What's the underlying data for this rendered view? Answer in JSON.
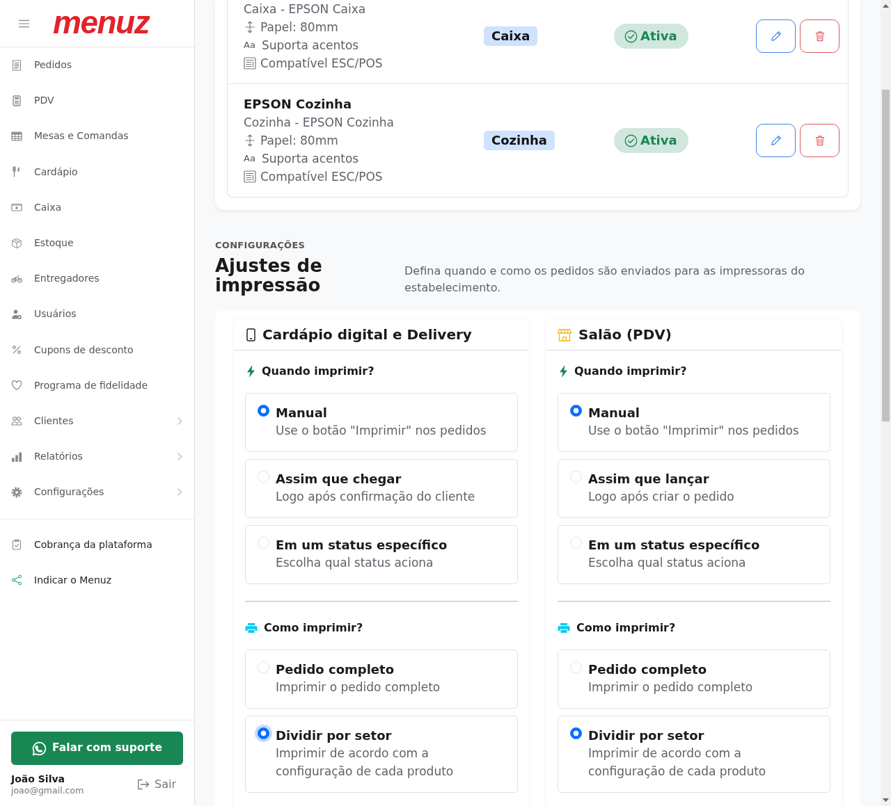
{
  "sidebar": {
    "logo": "menuz",
    "items": [
      {
        "label": "Pedidos",
        "has_submenu": false
      },
      {
        "label": "PDV",
        "has_submenu": false
      },
      {
        "label": "Mesas e Comandas",
        "has_submenu": false
      },
      {
        "label": "Cardápio",
        "has_submenu": false
      },
      {
        "label": "Caixa",
        "has_submenu": false
      },
      {
        "label": "Estoque",
        "has_submenu": false
      },
      {
        "label": "Entregadores",
        "has_submenu": false
      },
      {
        "label": "Usuários",
        "has_submenu": false
      },
      {
        "label": "Cupons de desconto",
        "has_submenu": false
      },
      {
        "label": "Programa de fidelidade",
        "has_submenu": false
      },
      {
        "label": "Clientes",
        "has_submenu": true
      },
      {
        "label": "Relatórios",
        "has_submenu": true
      },
      {
        "label": "Configurações",
        "has_submenu": true
      }
    ],
    "secondary_items": [
      {
        "label": "Cobrança da plataforma"
      },
      {
        "label": "Indicar o Menuz"
      }
    ],
    "support_button": "Falar com suporte",
    "user": {
      "name": "João Silva",
      "email": "joao@gmail.com"
    },
    "logout": "Sair"
  },
  "printers": [
    {
      "subtitle": "Caixa - EPSON Caixa",
      "details": [
        {
          "kind": "paper",
          "text": "Papel: 80mm"
        },
        {
          "kind": "accents",
          "glyph": "Aa",
          "text": "Suporta acentos"
        },
        {
          "kind": "escpos",
          "text": "Compatível ESC/POS"
        }
      ],
      "sector": "Caixa",
      "status": "Ativa"
    },
    {
      "name": "EPSON Cozinha",
      "subtitle": "Cozinha - EPSON Cozinha",
      "details": [
        {
          "kind": "paper",
          "text": "Papel: 80mm"
        },
        {
          "kind": "accents",
          "glyph": "Aa",
          "text": "Suporta acentos"
        },
        {
          "kind": "escpos",
          "text": "Compatível ESC/POS"
        }
      ],
      "sector": "Cozinha",
      "status": "Ativa"
    }
  ],
  "print_settings": {
    "eyebrow": "CONFIGURAÇÕES",
    "title": "Ajustes de impressão",
    "description": "Defina quando e como os pedidos são enviados para as impressoras do estabelecimento.",
    "channels": [
      {
        "title": "Cardápio digital e Delivery",
        "groups": [
          {
            "heading": "Quando imprimir?",
            "options": [
              {
                "title": "Manual",
                "description": "Use o botão \"Imprimir\" nos pedidos",
                "selected": true,
                "focused": false
              },
              {
                "title": "Assim que chegar",
                "description": "Logo após confirmação do cliente",
                "selected": false,
                "focused": false
              },
              {
                "title": "Em um status específico",
                "description": "Escolha qual status aciona",
                "selected": false,
                "focused": false
              }
            ]
          },
          {
            "heading": "Como imprimir?",
            "options": [
              {
                "title": "Pedido completo",
                "description": "Imprimir o pedido completo",
                "selected": false,
                "focused": false
              },
              {
                "title": "Dividir por setor",
                "description": "Imprimir de acordo com a configuração de cada produto",
                "selected": true,
                "focused": true
              }
            ]
          }
        ]
      },
      {
        "title": "Salão (PDV)",
        "groups": [
          {
            "heading": "Quando imprimir?",
            "options": [
              {
                "title": "Manual",
                "description": "Use o botão \"Imprimir\" nos pedidos",
                "selected": true,
                "focused": false
              },
              {
                "title": "Assim que lançar",
                "description": "Logo após criar o pedido",
                "selected": false,
                "focused": false
              },
              {
                "title": "Em um status específico",
                "description": "Escolha qual status aciona",
                "selected": false,
                "focused": false
              }
            ]
          },
          {
            "heading": "Como imprimir?",
            "options": [
              {
                "title": "Pedido completo",
                "description": "Imprimir o pedido completo",
                "selected": false,
                "focused": false
              },
              {
                "title": "Dividir por setor",
                "description": "Imprimir de acordo com a configuração de cada produto",
                "selected": true,
                "focused": false
              }
            ]
          }
        ]
      }
    ]
  }
}
